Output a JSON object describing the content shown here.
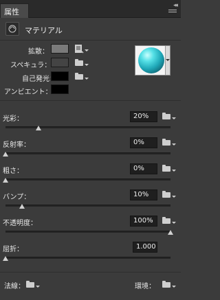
{
  "panel": {
    "tab_label": "属性"
  },
  "header": {
    "title": "マテリアル",
    "icon": "material-icon"
  },
  "colors": {
    "diffuse": "#7a7a7a",
    "specular": "#444444",
    "self_illumination": "#000000",
    "ambient": "#000000",
    "preview_accent": "#1fa8b8"
  },
  "rows": {
    "diffuse_label": "拡散：",
    "specular_label": "スペキュラ：",
    "self_illum_label": "自己発光：",
    "ambient_label": "アンビエント："
  },
  "sliders": [
    {
      "label": "光彩：",
      "value_text": "20%",
      "level": 0.2
    },
    {
      "label": "反射率：",
      "value_text": "0%",
      "level": 0.0
    },
    {
      "label": "粗さ：",
      "value_text": "0%",
      "level": 0.0
    },
    {
      "label": "バンプ：",
      "value_text": "10%",
      "level": 0.1
    },
    {
      "label": "不透明度：",
      "value_text": "100%",
      "level": 1.0
    },
    {
      "label": "屈折：",
      "value_text": "1.000",
      "level": 0.0
    }
  ],
  "footer": {
    "normal_label": "法線：",
    "environment_label": "環境："
  }
}
